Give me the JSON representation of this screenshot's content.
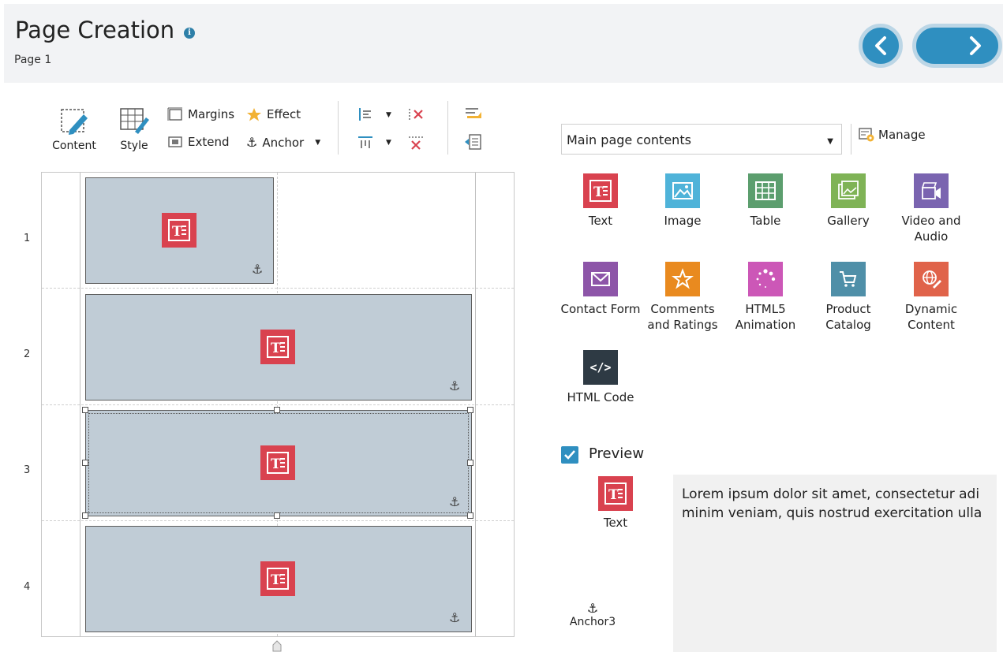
{
  "header": {
    "title": "Page Creation",
    "subtitle": "Page 1",
    "info_icon": "info-icon",
    "prev_icon": "chevron-left-icon",
    "next_icon": "chevron-right-icon"
  },
  "ribbon": {
    "content_label": "Content",
    "style_label": "Style",
    "margins_label": "Margins",
    "effect_label": "Effect",
    "extend_label": "Extend",
    "anchor_label": "Anchor"
  },
  "grid": {
    "rows": [
      "1",
      "2",
      "3",
      "4"
    ]
  },
  "objects_panel": {
    "dropdown_value": "Main page contents",
    "manage_label": "Manage",
    "widgets": [
      {
        "label": "Text",
        "color": "#d9424f",
        "icon": "text-icon"
      },
      {
        "label": "Image",
        "color": "#4fb3d9",
        "icon": "image-icon"
      },
      {
        "label": "Table",
        "color": "#5c9e6e",
        "icon": "table-icon"
      },
      {
        "label": "Gallery",
        "color": "#7fb356",
        "icon": "gallery-icon"
      },
      {
        "label": "Video and Audio",
        "color": "#7a64b0",
        "icon": "video-icon"
      },
      {
        "label": "Contact Form",
        "color": "#8d55a8",
        "icon": "envelope-icon"
      },
      {
        "label": "Comments and Ratings",
        "color": "#e98a1f",
        "icon": "star-icon"
      },
      {
        "label": "HTML5 Animation",
        "color": "#cc57b7",
        "icon": "animation-icon"
      },
      {
        "label": "Product Catalog",
        "color": "#4f8fa8",
        "icon": "cart-icon"
      },
      {
        "label": "Dynamic Content",
        "color": "#e0634a",
        "icon": "dynamic-icon"
      },
      {
        "label": "HTML Code",
        "color": "#2e3a44",
        "icon": "code-icon"
      }
    ],
    "code_glyph": "</>"
  },
  "preview": {
    "checked": true,
    "label": "Preview",
    "widget_label": "Text",
    "lorem_line1": "Lorem ipsum dolor sit amet, consectetur adi",
    "lorem_line2": "minim veniam, quis nostrud exercitation ulla",
    "anchor_label": "Anchor3"
  }
}
